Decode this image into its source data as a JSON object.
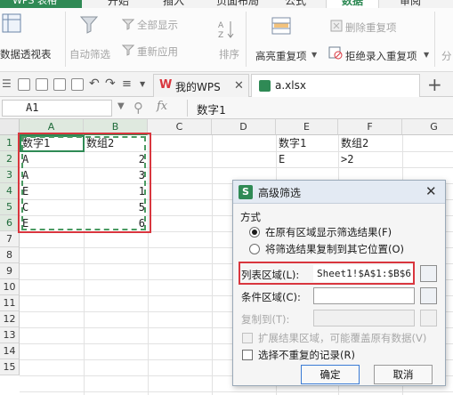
{
  "app": {
    "title": "WPS 表格",
    "menu_tabs": [
      "开始",
      "插入",
      "页面布局",
      "公式",
      "数据",
      "审阅"
    ],
    "active_menu_tab": "数据"
  },
  "ribbon": {
    "pivot_table": "数据透视表",
    "auto_filter": "自动筛选",
    "show_all": "全部显示",
    "reapply": "重新应用",
    "sort": "排序",
    "highlight_duplicates": "高亮重复项",
    "remove_duplicates": "删除重复项",
    "reject_duplicates": "拒绝录入重复项",
    "split": "分"
  },
  "doc_tabs": [
    {
      "label": "我的WPS",
      "active": false
    },
    {
      "label": "a.xlsx",
      "active": true
    }
  ],
  "formula_bar": {
    "name_box": "A1",
    "fx": "fx",
    "content": "数字1"
  },
  "sheet": {
    "columns": [
      "A",
      "B",
      "C",
      "D",
      "E",
      "F",
      "G"
    ],
    "rows": [
      "1",
      "2",
      "3",
      "4",
      "5",
      "6",
      "7",
      "8",
      "9",
      "10",
      "11",
      "12",
      "13",
      "14",
      "15"
    ],
    "cells": {
      "A1": "数字1",
      "B1": "数组2",
      "A2": "A",
      "B2": "2",
      "A3": "A",
      "B3": "3",
      "A4": "E",
      "B4": "1",
      "A5": "C",
      "B5": "5",
      "A6": "E",
      "B6": "6",
      "E1": "数字1",
      "F1": "数组2",
      "E2": "E",
      "F2": ">2"
    }
  },
  "dialog": {
    "title": "高级筛选",
    "section_label": "方式",
    "radio_in_place": "在原有区域显示筛选结果(F)",
    "radio_copy": "将筛选结果复制到其它位置(O)",
    "list_range_label": "列表区域(L):",
    "list_range_value": "Sheet1!$A$1:$B$6",
    "criteria_range_label": "条件区域(C):",
    "criteria_range_value": "",
    "copy_to_label": "复制到(T):",
    "copy_to_value": "",
    "expand_label": "扩展结果区域，可能覆盖原有数据(V)",
    "unique_label": "选择不重复的记录(R)",
    "ok_label": "确定",
    "cancel_label": "取消"
  },
  "colors": {
    "accent": "#2f8a55",
    "highlight_red": "#d9363e",
    "selection_green": "#2f8a55"
  }
}
